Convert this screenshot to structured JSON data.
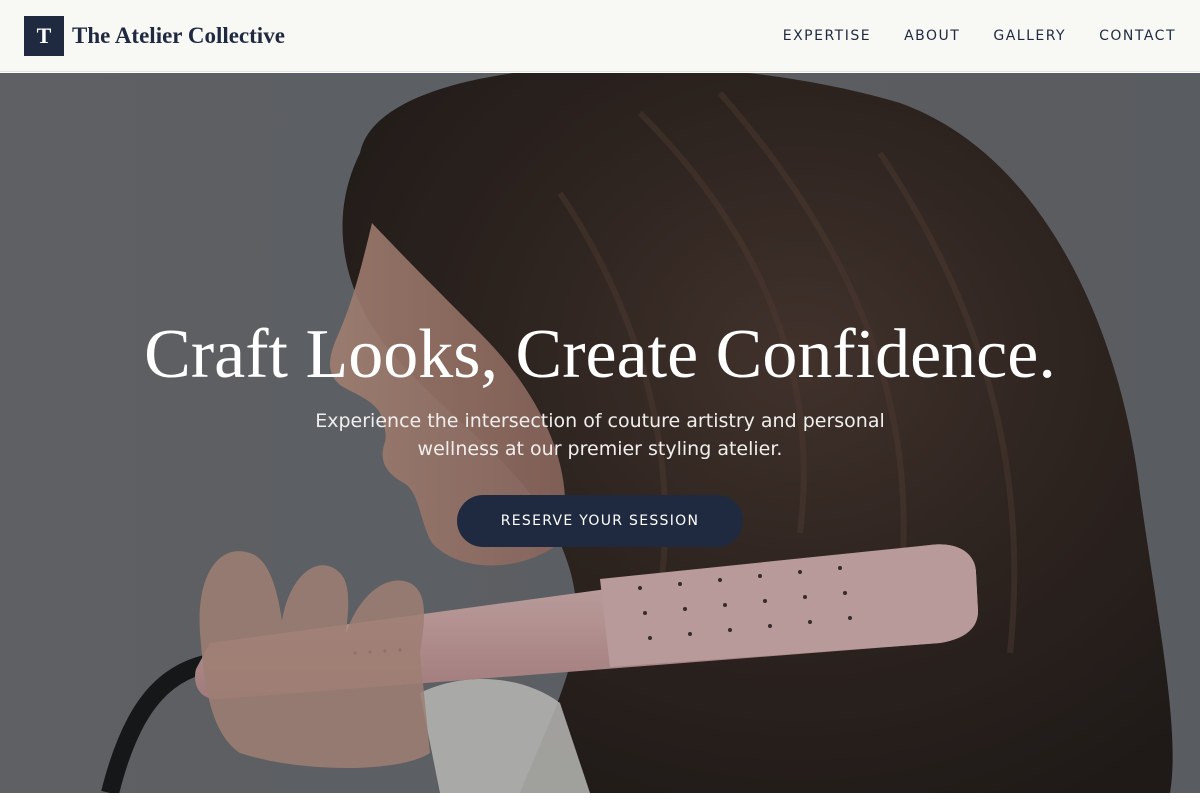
{
  "brand": {
    "logo_letter": "T",
    "name": "The Atelier Collective"
  },
  "nav": {
    "items": [
      {
        "label": "EXPERTISE"
      },
      {
        "label": "ABOUT"
      },
      {
        "label": "GALLERY"
      },
      {
        "label": "CONTACT"
      }
    ]
  },
  "hero": {
    "title": "Craft Looks, Create Confidence.",
    "subtitle": "Experience the intersection of couture artistry and personal wellness at our premier styling atelier.",
    "cta_label": "RESERVE YOUR SESSION",
    "image_alt": "Woman with long wavy brown hair styling with a pink flat iron"
  },
  "colors": {
    "primary": "#1f2a40",
    "header_bg": "#f8f8f5",
    "hero_backdrop": "#6d6f73",
    "hair": "#2a1c16",
    "iron": "#e6bcbc"
  }
}
